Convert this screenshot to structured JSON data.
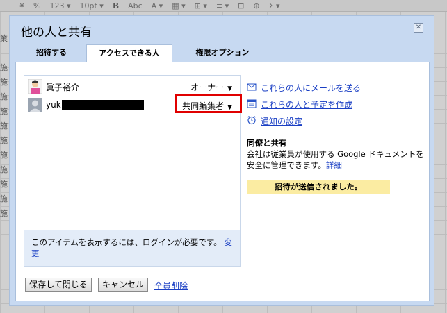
{
  "background": {
    "toolbar_items": [
      "¥",
      "%",
      "123 ▾",
      "10pt ▾",
      "B",
      "Abc",
      "A ▾",
      "▦ ▾",
      "⊞ ▾",
      "≡ ▾",
      "⊟",
      "⊕",
      "Σ ▾"
    ],
    "row_labels": [
      "業",
      "",
      "施",
      "施",
      "施",
      "施",
      "施",
      "施",
      "施",
      "施",
      "施",
      "施",
      "施"
    ]
  },
  "dialog": {
    "title": "他の人と共有",
    "close_label": "✕",
    "tabs": [
      {
        "label": "招待する",
        "active": false
      },
      {
        "label": "アクセスできる人",
        "active": true
      },
      {
        "label": "権限オプション",
        "active": false
      }
    ],
    "people": [
      {
        "name": "眞子裕介",
        "role": "オーナー",
        "avatar": "person-avatar-icon"
      },
      {
        "name": "yuk",
        "role": "共同編集者",
        "avatar": "default-avatar-icon",
        "redacted": true
      }
    ],
    "login_note": {
      "text": "このアイテムを表示するには、ログインが必要です。",
      "link": "変更"
    },
    "actions": [
      {
        "label": "これらの人にメールを送る",
        "icon": "mail-icon"
      },
      {
        "label": "これらの人と予定を作成",
        "icon": "calendar-icon"
      },
      {
        "label": "通知の設定",
        "icon": "alarm-clock-icon"
      }
    ],
    "info": {
      "title": "同僚と共有",
      "text": "会社は従業員が使用する Google ドキュメントを安全に管理できます。",
      "link": "詳細"
    },
    "notice": "招待が送信されました。",
    "buttons": {
      "save_close": "保存して閉じる",
      "cancel": "キャンセル",
      "remove_all": "全員削除"
    }
  },
  "colors": {
    "dialog_bg": "#c7d9f1",
    "link": "#1a3fc4",
    "notice_bg": "#fbeca2",
    "highlight": "#e00000"
  }
}
